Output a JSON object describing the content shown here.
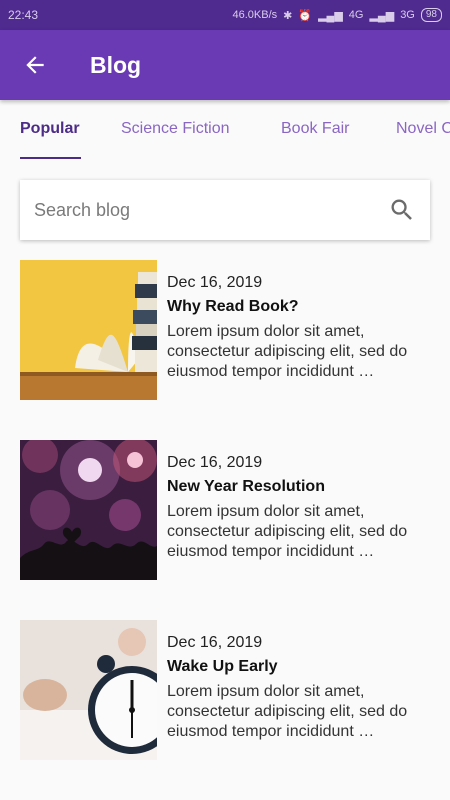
{
  "status_bar": {
    "time": "22:43",
    "network_speed": "46.0KB/s",
    "net1": "4G",
    "net2": "3G",
    "battery": "98"
  },
  "app_bar": {
    "title": "Blog"
  },
  "tabs": [
    {
      "label": "Popular"
    },
    {
      "label": "Science Fiction"
    },
    {
      "label": "Book Fair"
    },
    {
      "label": "Novel C"
    }
  ],
  "search": {
    "placeholder": "Search blog"
  },
  "posts": [
    {
      "date": "Dec 16, 2019",
      "title": "Why Read Book?",
      "excerpt": "Lorem ipsum dolor sit amet, consectetur adipiscing elit, sed do eiusmod tempor incididunt …"
    },
    {
      "date": "Dec 16, 2019",
      "title": "New Year Resolution",
      "excerpt": "Lorem ipsum dolor sit amet, consectetur adipiscing elit, sed do eiusmod tempor incididunt …"
    },
    {
      "date": "Dec 16, 2019",
      "title": "Wake Up Early",
      "excerpt": "Lorem ipsum dolor sit amet, consectetur adipiscing elit, sed do eiusmod tempor incididunt …"
    }
  ],
  "colors": {
    "status_bar": "#4f2a8f",
    "app_bar": "#6a3ab4",
    "tab_active": "#4d2c87",
    "tab_inactive": "#8a66c3"
  }
}
